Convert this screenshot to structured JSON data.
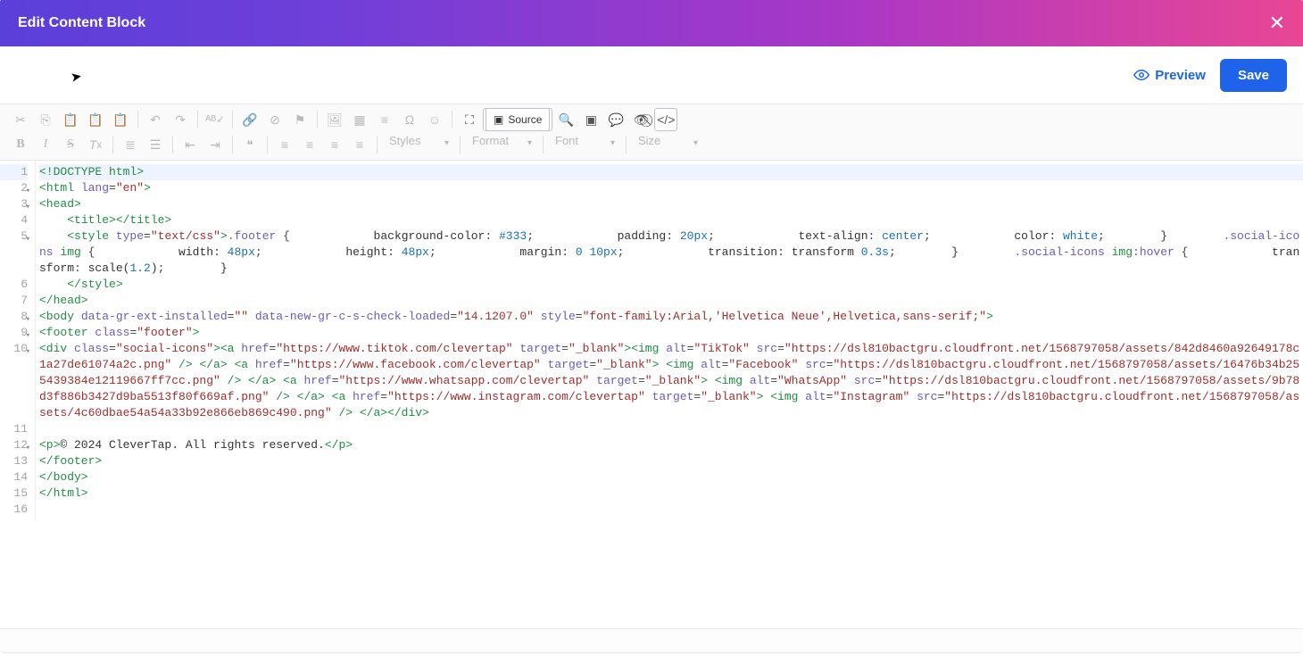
{
  "header": {
    "title": "Edit Content Block"
  },
  "actions": {
    "preview": "Preview",
    "save": "Save"
  },
  "toolbar": {
    "source_label": "Source",
    "styles": "Styles",
    "format": "Format",
    "font": "Font",
    "size": "Size"
  },
  "code": {
    "line1": "<!DOCTYPE html>",
    "line2_open": "<",
    "line2_tag": "html",
    "line2_attr": " lang",
    "line2_eq": "=",
    "line2_val": "\"en\"",
    "line2_close": ">",
    "line3": "<head>",
    "line4_pre": "    ",
    "line4": "<title></title>",
    "line5_pre": "    ",
    "line5_a": "<style ",
    "line5_attr": "type",
    "line5_eq": "=",
    "line5_val": "\"text/css\"",
    "line5_b": ">",
    "line5_sel1": ".footer ",
    "line5_brace": "{",
    "line5_prop1": "            background-color",
    "line5_col": ": ",
    "line5_pv1": "#333",
    "line5_semi": ";",
    "line5_prop2": "            padding",
    "line5_pv2": "20px",
    "line5_prop3": "            text-align",
    "line5_pv3": "center",
    "line5_prop4": "            color",
    "line5_pv4": "white",
    "line5_end": "        }        ",
    "line5b_sel": ".social-icons ",
    "line5b_tag": "img ",
    "line5b_brace": "{",
    "line5b_p1": "            width",
    "line5b_v1": "48px",
    "line5b_p2": "            height",
    "line5b_v2": "48px",
    "line5b_p3": "            margin",
    "line5b_v3a": "0 ",
    "line5b_v3b": "10px",
    "line5b_p4": "            transition",
    "line5b_v4": "transform 0.3s",
    "line5b_end": "        }        ",
    "line5c_sel": ".social-icons ",
    "line5c_tag": "img",
    "line5c_pseudo": ":hover        ",
    "line5c_brace": "{",
    "line5c_p1": "            transform",
    "line5c_v1": "scale(",
    "line5c_num": "1.2",
    "line5c_v1b": ")",
    "line5c_end": "        }",
    "line6_pre": "    ",
    "line6": "</style>",
    "line7": "</head>",
    "line8_a": "<body ",
    "line8_attr1": "data-gr-ext-installed",
    "line8_v1": "\"\"",
    "line8_attr2": " data-new-gr-c-s-check-loaded",
    "line8_v2": "\"14.1207.0\"",
    "line8_attr3": " style",
    "line8_v3": "\"font-family:Arial,'Helvetica Neue',Helvetica,sans-serif;\"",
    "line8_close": ">",
    "line9_a": "<footer ",
    "line9_attr": "class",
    "line9_v": "\"footer\"",
    "line9_close": ">",
    "line10_a": "<div ",
    "line10_attr1": "class",
    "line10_v1": "\"social-icons\"",
    "line10_b": "><a ",
    "line10_attr2": "href",
    "line10_v2": "\"https://www.tiktok.com/clevertap\"",
    "line10_attr3": " target",
    "line10_v3": "\"_blank\"",
    "line10_c": "><img ",
    "line10_attr4": "alt",
    "line10_v4": "\"TikTok\"",
    "line10_attr5": "src",
    "line10_v5": "\"https://dsl810bactgru.cloudfront.net/1568797058/assets/842d8460a92649178c1a27de61074a2c.png\"",
    "line10_d": " /> </a> <a ",
    "line10_attr6": "href",
    "line10_v6": "\"https://www.facebook.com/clevertap\"",
    "line10_attr7": " target",
    "line10_v7": "\"_blank\"",
    "line10_e": "> <img",
    "line10_attr8": "alt",
    "line10_v8": "\"Facebook\"",
    "line10_attr9": " src",
    "line10_v9": "\"https://dsl810bactgru.cloudfront.net/1568797058/assets/16476b34b255439384e12119667ff7cc.png\"",
    "line10_f": " /> </a> <a ",
    "line10_attr10": "href",
    "line10_v10": "\"https://www.whatsapp.com/clevertap\"",
    "line10_g": "target",
    "line10_v11": "\"_blank\"",
    "line10_h": "> <img ",
    "line10_attr12": "alt",
    "line10_v12": "\"WhatsApp\"",
    "line10_attr13": " src",
    "line10_v13": "\"https://dsl810bactgru.cloudfront.net/1568797058/assets/9b78d3f886b3427d9ba5513f80f669af.png\"",
    "line10_i": " /> </a> <a",
    "line10_attr14": "href",
    "line10_v14": "\"https://www.instagram.com/clevertap\"",
    "line10_attr15": " target",
    "line10_v15": "\"_blank\"",
    "line10_j": "> <img ",
    "line10_attr16": "alt",
    "line10_v16": "\"Instagram\"",
    "line10_attr17": " src",
    "line10_v17": "\"https://dsl810bactgru.cloudfront.net/1568797058/assets/4c60dbae54a54a33b92e866eb869c490.png\"",
    "line10_k": "/> </a></div>",
    "line12_a": "<p>",
    "line12_txt": "© 2024 CleverTap. All rights reserved.",
    "line12_b": "</p>",
    "line13": "</footer>",
    "line14": "</body>",
    "line15": "</html>"
  },
  "line_numbers": [
    "1",
    "2",
    "3",
    "4",
    "5",
    "6",
    "7",
    "8",
    "9",
    "10",
    "11",
    "12",
    "13",
    "14",
    "15",
    "16"
  ],
  "fold_lines": [
    2,
    3,
    5,
    8,
    9,
    10,
    12
  ],
  "highlight_line": 1
}
